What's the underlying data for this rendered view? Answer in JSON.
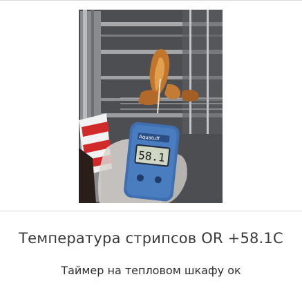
{
  "post": {
    "title": "Температура стрипсов OR +58.1C",
    "caption": "Таймер на тепловом шкафу ок",
    "photo": {
      "icon": "thermometer-photo",
      "thermometer_brand": "Aquatuff",
      "thermometer_reading": "58.1"
    }
  }
}
